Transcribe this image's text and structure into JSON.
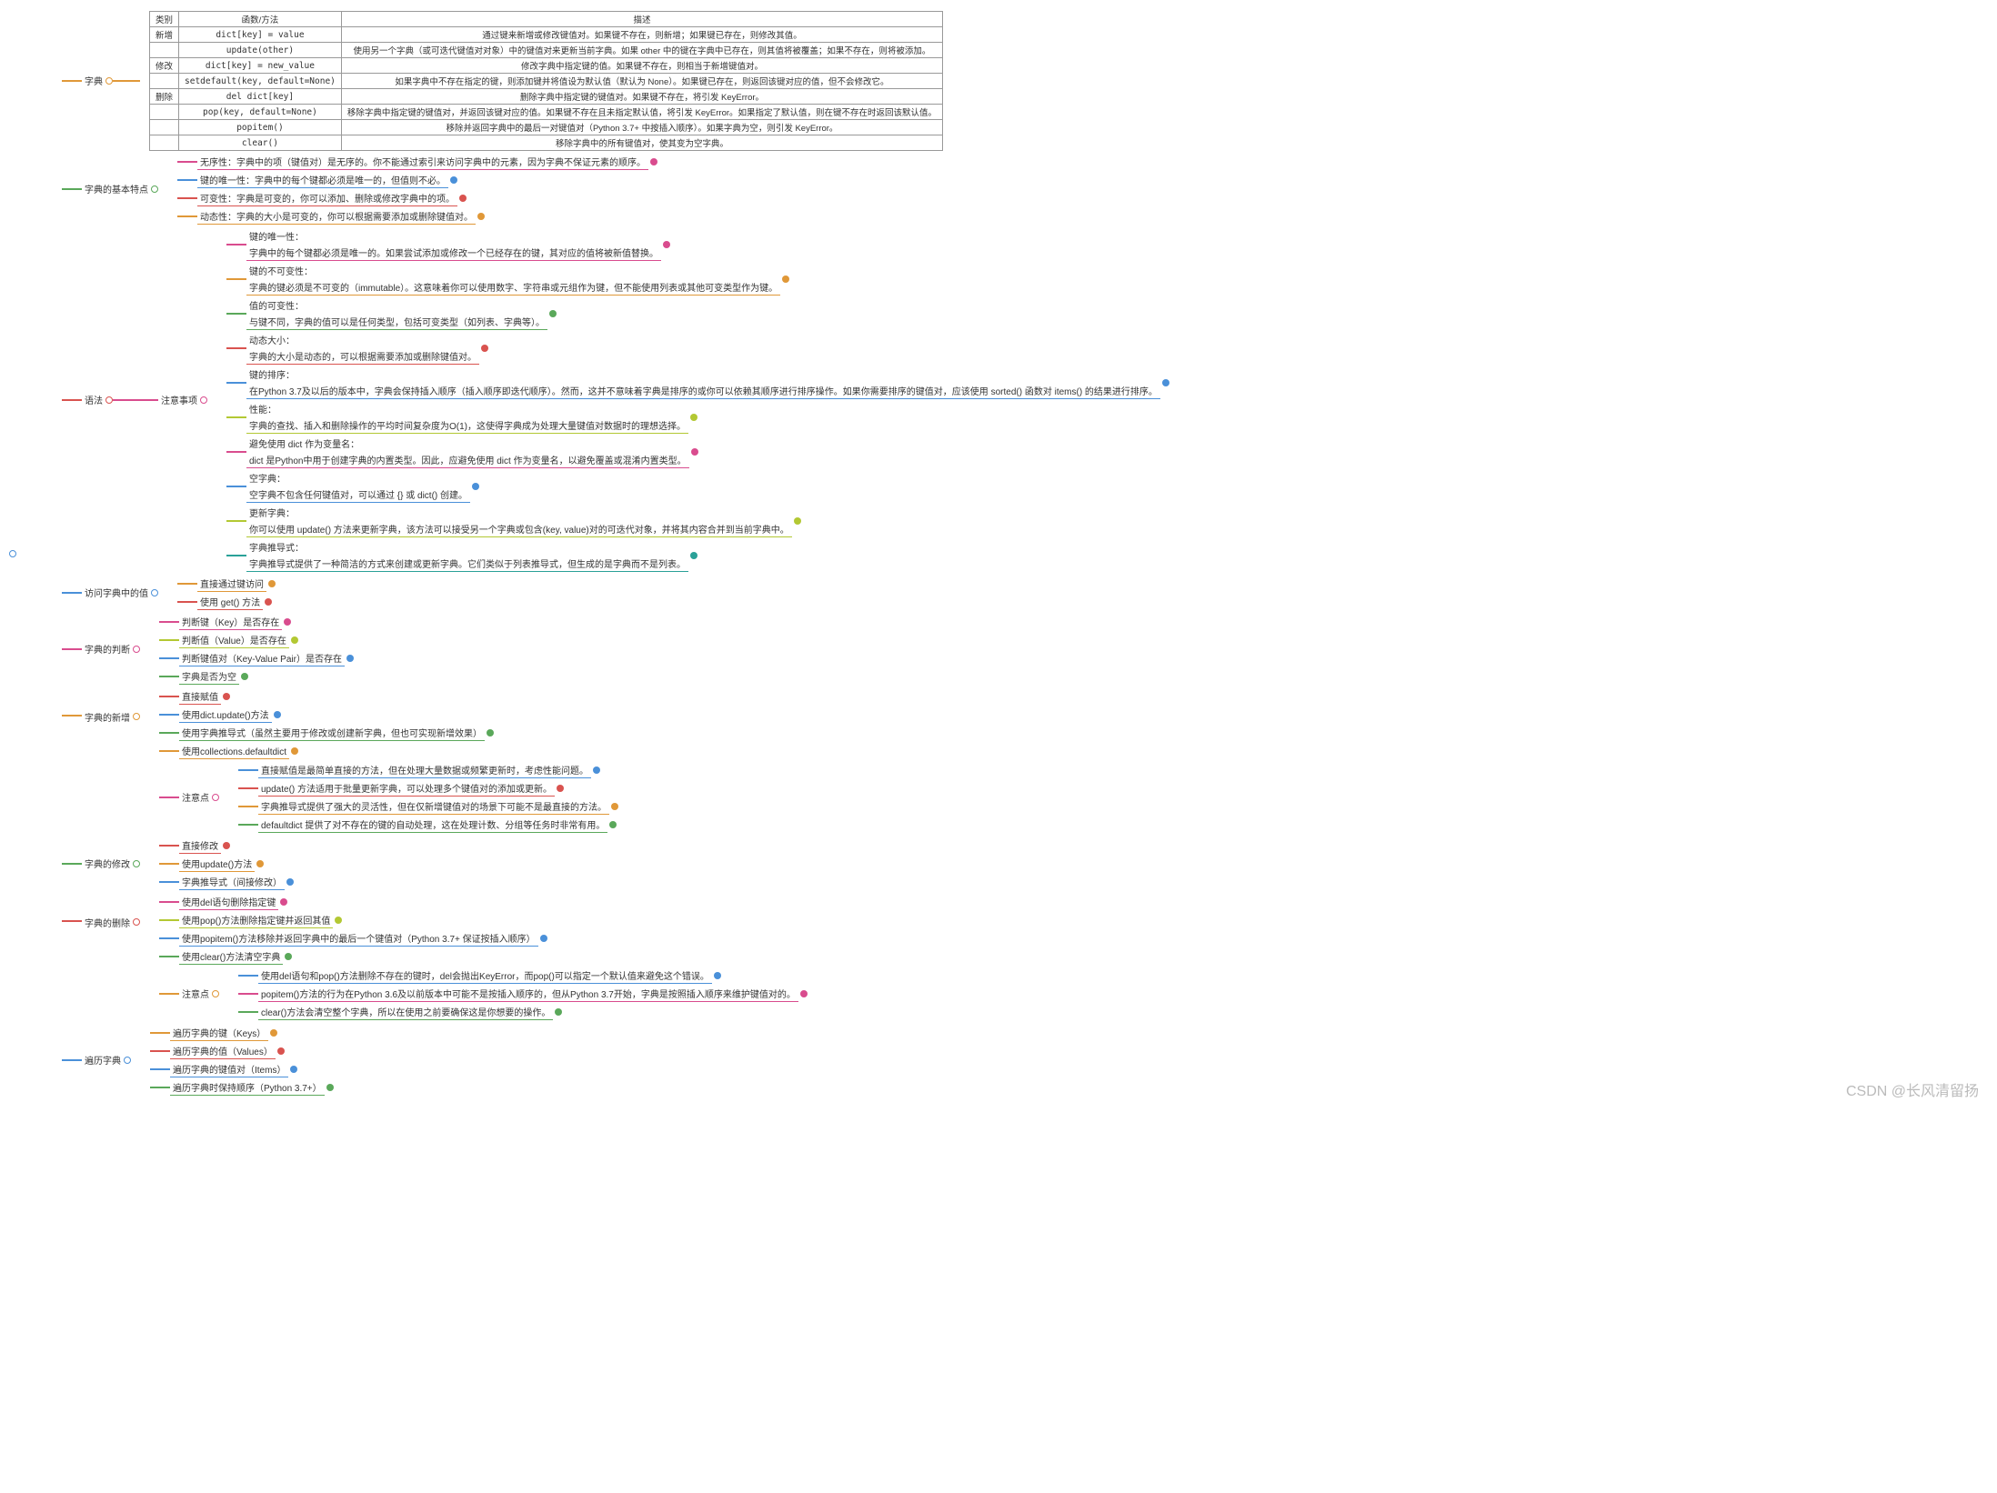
{
  "watermark": "CSDN @长风清留扬",
  "table": {
    "headers": [
      "类别",
      "函数/方法",
      "描述"
    ],
    "rows": [
      [
        "新增",
        "dict[key] = value",
        "通过键来新增或修改键值对。如果键不存在，则新增；如果键已存在，则修改其值。"
      ],
      [
        "",
        "update(other)",
        "使用另一个字典（或可迭代键值对对象）中的键值对来更新当前字典。如果 other 中的键在字典中已存在，则其值将被覆盖；如果不存在，则将被添加。"
      ],
      [
        "修改",
        "dict[key] = new_value",
        "修改字典中指定键的值。如果键不存在，则相当于新增键值对。"
      ],
      [
        "",
        "setdefault(key, default=None)",
        "如果字典中不存在指定的键，则添加键并将值设为默认值（默认为 None）。如果键已存在，则返回该键对应的值，但不会修改它。"
      ],
      [
        "删除",
        "del dict[key]",
        "删除字典中指定键的键值对。如果键不存在，将引发 KeyError。"
      ],
      [
        "",
        "pop(key, default=None)",
        "移除字典中指定键的键值对，并返回该键对应的值。如果键不存在且未指定默认值，将引发 KeyError。如果指定了默认值，则在键不存在时返回该默认值。"
      ],
      [
        "",
        "popitem()",
        "移除并返回字典中的最后一对键值对（Python 3.7+ 中按插入顺序）。如果字典为空，则引发 KeyError。"
      ],
      [
        "",
        "clear()",
        "移除字典中的所有键值对，使其变为空字典。"
      ]
    ]
  },
  "root": "",
  "sections": {
    "s1": {
      "label": "字典"
    },
    "s2": {
      "label": "字典的基本特点",
      "items": {
        "a": "无序性：字典中的项（键值对）是无序的。你不能通过索引来访问字典中的元素，因为字典不保证元素的顺序。",
        "b": "键的唯一性：字典中的每个键都必须是唯一的，但值则不必。",
        "c": "可变性：字典是可变的，你可以添加、删除或修改字典中的项。",
        "d": "动态性：字典的大小是可变的，你可以根据需要添加或删除键值对。"
      }
    },
    "s3": {
      "label": "语法",
      "sub": {
        "label": "注意事项",
        "items": {
          "a1": "键的唯一性：",
          "a2": "字典中的每个键都必须是唯一的。如果尝试添加或修改一个已经存在的键，其对应的值将被新值替换。",
          "b1": "键的不可变性：",
          "b2": "字典的键必须是不可变的（immutable）。这意味着你可以使用数字、字符串或元组作为键，但不能使用列表或其他可变类型作为键。",
          "c1": "值的可变性：",
          "c2": "与键不同，字典的值可以是任何类型，包括可变类型（如列表、字典等）。",
          "d1": "动态大小：",
          "d2": "字典的大小是动态的，可以根据需要添加或删除键值对。",
          "e1": "键的排序：",
          "e2": "在Python 3.7及以后的版本中，字典会保持插入顺序（插入顺序即迭代顺序）。然而，这并不意味着字典是排序的或你可以依赖其顺序进行排序操作。如果你需要排序的键值对，应该使用 sorted() 函数对 items() 的结果进行排序。",
          "f1": "性能：",
          "f2": "字典的查找、插入和删除操作的平均时间复杂度为O(1)，这使得字典成为处理大量键值对数据时的理想选择。",
          "g1": "避免使用 dict 作为变量名：",
          "g2": "dict 是Python中用于创建字典的内置类型。因此，应避免使用 dict 作为变量名，以避免覆盖或混淆内置类型。",
          "h1": "空字典：",
          "h2": "空字典不包含任何键值对，可以通过 {} 或 dict() 创建。",
          "i1": "更新字典：",
          "i2": "你可以使用 update() 方法来更新字典，该方法可以接受另一个字典或包含(key, value)对的可迭代对象，并将其内容合并到当前字典中。",
          "j1": "字典推导式：",
          "j2": "字典推导式提供了一种简洁的方式来创建或更新字典。它们类似于列表推导式，但生成的是字典而不是列表。"
        }
      }
    },
    "s4": {
      "label": "访问字典中的值",
      "items": {
        "a": "直接通过键访问",
        "b": "使用 get() 方法"
      }
    },
    "s5": {
      "label": "字典的判断",
      "items": {
        "a": "判断键（Key）是否存在",
        "b": "判断值（Value）是否存在",
        "c": "判断键值对（Key-Value Pair）是否存在",
        "d": "字典是否为空"
      }
    },
    "s6": {
      "label": "字典的新增",
      "items": {
        "a": "直接赋值",
        "b": "使用dict.update()方法",
        "c": "使用字典推导式（虽然主要用于修改或创建新字典，但也可实现新增效果）",
        "d": "使用collections.defaultdict"
      },
      "notes": {
        "label": "注意点",
        "items": {
          "a": "直接赋值是最简单直接的方法，但在处理大量数据或频繁更新时，考虑性能问题。",
          "b": "update() 方法适用于批量更新字典，可以处理多个键值对的添加或更新。",
          "c": "字典推导式提供了强大的灵活性，但在仅新增键值对的场景下可能不是最直接的方法。",
          "d": "defaultdict 提供了对不存在的键的自动处理，这在处理计数、分组等任务时非常有用。"
        }
      }
    },
    "s7": {
      "label": "字典的修改",
      "items": {
        "a": "直接修改",
        "b": "使用update()方法",
        "c": "字典推导式（间接修改）"
      }
    },
    "s8": {
      "label": "字典的删除",
      "items": {
        "a": "使用del语句删除指定键",
        "b": "使用pop()方法删除指定键并返回其值",
        "c": "使用popitem()方法移除并返回字典中的最后一个键值对（Python 3.7+ 保证按插入顺序）",
        "d": "使用clear()方法清空字典"
      },
      "notes": {
        "label": "注意点",
        "items": {
          "a": "使用del语句和pop()方法删除不存在的键时，del会抛出KeyError，而pop()可以指定一个默认值来避免这个错误。",
          "b": "popitem()方法的行为在Python 3.6及以前版本中可能不是按插入顺序的，但从Python 3.7开始，字典是按照插入顺序来维护键值对的。",
          "c": "clear()方法会清空整个字典，所以在使用之前要确保这是你想要的操作。"
        }
      }
    },
    "s9": {
      "label": "遍历字典",
      "items": {
        "a": "遍历字典的键（Keys）",
        "b": "遍历字典的值（Values）",
        "c": "遍历字典的键值对（Items）",
        "d": "遍历字典时保持顺序（Python 3.7+）"
      }
    }
  }
}
